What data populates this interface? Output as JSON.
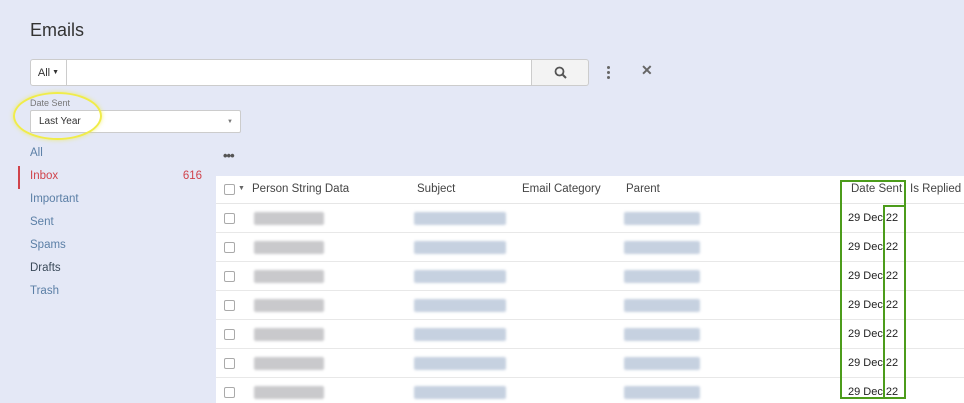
{
  "page_title": "Emails",
  "search": {
    "scope_label": "All",
    "value": "",
    "placeholder": ""
  },
  "filter": {
    "label": "Date Sent",
    "selected": "Last Year"
  },
  "nav": {
    "items": [
      {
        "label": "All",
        "count": ""
      },
      {
        "label": "Inbox",
        "count": "616"
      },
      {
        "label": "Important",
        "count": ""
      },
      {
        "label": "Sent",
        "count": ""
      },
      {
        "label": "Spams",
        "count": ""
      },
      {
        "label": "Drafts",
        "count": ""
      },
      {
        "label": "Trash",
        "count": ""
      }
    ]
  },
  "more_label": "•••",
  "table": {
    "columns": [
      "Person String Data",
      "Subject",
      "Email Category",
      "Parent",
      "Date Sent",
      "Is Replied"
    ],
    "rows": [
      {
        "date": "29 Dec",
        "year": "22"
      },
      {
        "date": "29 Dec",
        "year": "22"
      },
      {
        "date": "29 Dec",
        "year": "22"
      },
      {
        "date": "29 Dec",
        "year": "22"
      },
      {
        "date": "29 Dec",
        "year": "22"
      },
      {
        "date": "29 Dec",
        "year": "22"
      },
      {
        "date": "29 Dec",
        "year": "22"
      }
    ]
  },
  "colors": {
    "active": "#d0434b",
    "link": "#5b7fa6",
    "highlight_annotation": "#4c9c1b",
    "ellipse_annotation": "#f0ec4a"
  }
}
